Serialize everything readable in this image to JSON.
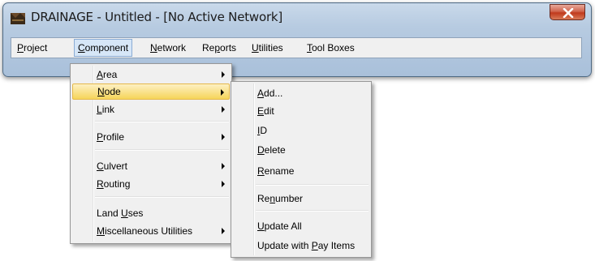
{
  "window": {
    "title": "DRAINAGE - Untitled - [No Active Network]",
    "icons": {
      "app": "drainage-app-icon",
      "close": "close-icon"
    }
  },
  "menubar": {
    "items": [
      {
        "label": "Project",
        "mnemonic": "P"
      },
      {
        "label": "Component",
        "mnemonic": "C"
      },
      {
        "label": "Network",
        "mnemonic": "N"
      },
      {
        "label": "Reports",
        "mnemonic": "p"
      },
      {
        "label": "Utilities",
        "mnemonic": "U"
      },
      {
        "label": "Tool Boxes",
        "mnemonic": "T"
      }
    ],
    "active": "Component"
  },
  "component_menu": {
    "items": [
      {
        "label": "Area",
        "submenu": true
      },
      {
        "label": "Node",
        "submenu": true,
        "highlighted": true
      },
      {
        "label": "Link",
        "submenu": true
      },
      {
        "label": "Profile",
        "submenu": true
      },
      {
        "label": "Culvert",
        "submenu": true
      },
      {
        "label": "Routing",
        "submenu": true
      },
      {
        "label": "Land Uses",
        "submenu": false
      },
      {
        "label": "Miscellaneous Utilities",
        "submenu": true
      }
    ]
  },
  "node_submenu": {
    "items": [
      {
        "label": "Add..."
      },
      {
        "label": "Edit"
      },
      {
        "label": "ID"
      },
      {
        "label": "Delete"
      },
      {
        "label": "Rename"
      },
      {
        "label": "Renumber"
      },
      {
        "label": "Update All"
      },
      {
        "label": "Update with Pay Items"
      }
    ]
  },
  "colors": {
    "highlight": "#f6d55a",
    "menu_bg": "#f0f0f0",
    "frame": "#b7cbe1"
  }
}
